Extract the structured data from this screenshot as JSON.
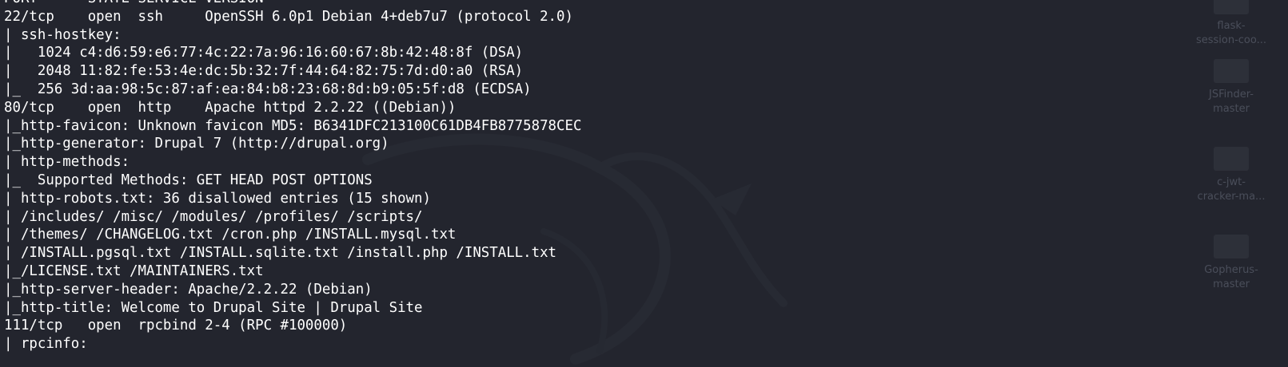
{
  "theme": {
    "background": "#23252e",
    "text_color": "#ffffff",
    "desktop_label_color": "#4a4e5a"
  },
  "desktop": {
    "icons": [
      {
        "label_line1": "flask-",
        "label_line2": "session-coo...",
        "icon": "folder-icon"
      },
      {
        "label_line1": "JSFinder-",
        "label_line2": "master",
        "icon": "folder-icon"
      },
      {
        "label_line1": "c-jwt-",
        "label_line2": "cracker-ma...",
        "icon": "folder-icon"
      },
      {
        "label_line1": "Gopherus-",
        "label_line2": "master",
        "icon": "folder-icon"
      }
    ],
    "watermark": "kali-dragon-icon"
  },
  "terminal": {
    "lines": [
      "PORT      STATE SERVICE VERSION",
      "22/tcp    open  ssh     OpenSSH 6.0p1 Debian 4+deb7u7 (protocol 2.0)",
      "| ssh-hostkey: ",
      "|   1024 c4:d6:59:e6:77:4c:22:7a:96:16:60:67:8b:42:48:8f (DSA)",
      "|   2048 11:82:fe:53:4e:dc:5b:32:7f:44:64:82:75:7d:d0:a0 (RSA)",
      "|_  256 3d:aa:98:5c:87:af:ea:84:b8:23:68:8d:b9:05:5f:d8 (ECDSA)",
      "80/tcp    open  http    Apache httpd 2.2.22 ((Debian))",
      "|_http-favicon: Unknown favicon MD5: B6341DFC213100C61DB4FB8775878CEC",
      "|_http-generator: Drupal 7 (http://drupal.org)",
      "| http-methods: ",
      "|_  Supported Methods: GET HEAD POST OPTIONS",
      "| http-robots.txt: 36 disallowed entries (15 shown)",
      "| /includes/ /misc/ /modules/ /profiles/ /scripts/ ",
      "| /themes/ /CHANGELOG.txt /cron.php /INSTALL.mysql.txt ",
      "| /INSTALL.pgsql.txt /INSTALL.sqlite.txt /install.php /INSTALL.txt ",
      "|_/LICENSE.txt /MAINTAINERS.txt",
      "|_http-server-header: Apache/2.2.22 (Debian)",
      "|_http-title: Welcome to Drupal Site | Drupal Site",
      "111/tcp   open  rpcbind 2-4 (RPC #100000)",
      "| rpcinfo: "
    ]
  }
}
